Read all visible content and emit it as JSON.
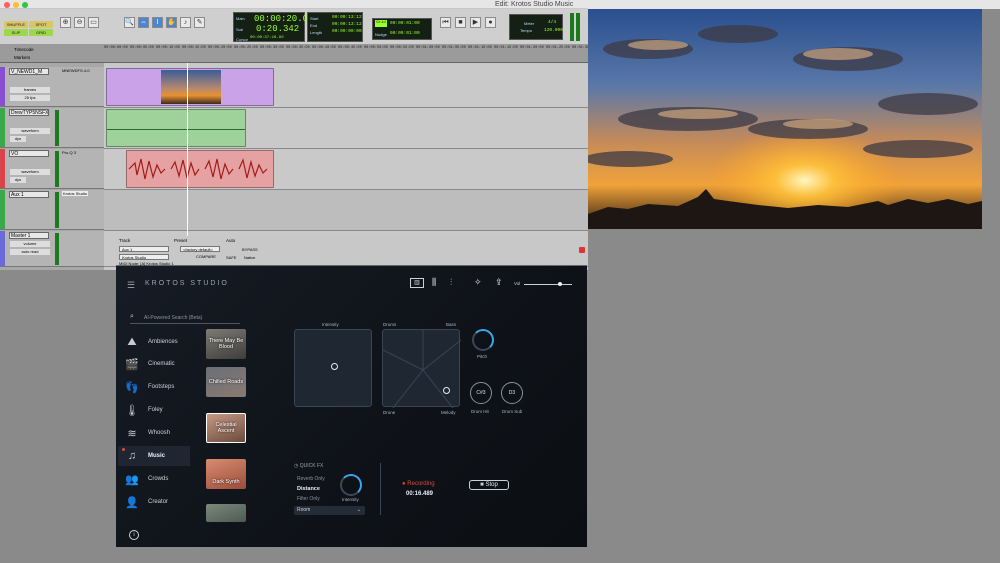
{
  "protools": {
    "window_title": "Edit: Krotos Studio Music",
    "modes": [
      "SHUFFLE",
      "SPOT",
      "SLIP",
      "GRID"
    ],
    "counters": {
      "main_label": "Main",
      "main_value": "00:00:20.08",
      "sub_label": "Sub",
      "sub_value": "0:20.342",
      "start_label": "Start",
      "start_value": "00:00:13:12",
      "end_label": "End",
      "end_value": "00:00:13:12",
      "length_label": "Length",
      "length_value": "00:00:00:00",
      "cursor_label": "Cursor",
      "cursor_value": "00:00:37:16.90",
      "nudge_label": "Nudge",
      "nudge_value": "00:00:01:00",
      "grid_value": "00:00:01:00"
    },
    "tempo": {
      "meter_label": "Meter",
      "meter_value": "4/4",
      "tempo_label": "Tempo",
      "tempo_value": "120.000"
    },
    "ruler": {
      "timecode_label": "Timecode",
      "markers_label": "Markers",
      "ticks": [
        "00:00:00:00",
        "00:00:05:00",
        "00:00:10:00",
        "00:00:15:00",
        "00:00:20:00",
        "00:00:25:00",
        "00:00:30:00",
        "00:00:35:00",
        "00:00:40:00",
        "00:00:45:00",
        "00:00:50:00",
        "00:00:55:00",
        "00:01:00:00",
        "00:01:05:00",
        "00:01:10:00",
        "00:01:15:00",
        "00:01:20:00",
        "00:01:25:00",
        "00:01:30:00"
      ]
    },
    "tracks": [
      {
        "name": "V_NEWD1_M",
        "insert": "MNEWDFS.4-0",
        "sub1": "frames",
        "sub2": "25 fps"
      },
      {
        "name": "DrewTYP5NSFX",
        "insert": "",
        "sub1": "waveform",
        "sub2": "dyn"
      },
      {
        "name": "VO",
        "insert": "Pro-Q 3",
        "sub1": "waveform",
        "sub2": "dyn"
      },
      {
        "name": "Aux 1",
        "insert": "Krotos Studio",
        "sub1": "",
        "sub2": ""
      },
      {
        "name": "Master 1",
        "insert": "",
        "sub1": "volume",
        "sub2": "auto read"
      }
    ]
  },
  "video": {
    "window_title": ""
  },
  "plugin_header": {
    "track_label": "Track",
    "track_value": "Aux 1",
    "preset_label": "Preset",
    "preset_value": "<factory default>",
    "auto_label": "Auto",
    "bypass": "BYPASS",
    "compare": "COMPARE",
    "safe": "SAFE",
    "native": "Native",
    "instance": "Krotos Studio",
    "node": "MIDI Node: [A] Krotos Studio 1"
  },
  "krotos": {
    "logo": "KROTOS STUDIO",
    "search_placeholder": "AI-Powered Search (Beta)",
    "vol_label": "Vol",
    "nav": [
      "Ambiences",
      "Cinematic",
      "Footsteps",
      "Foley",
      "Whoosh",
      "Music",
      "Crowds",
      "Creator"
    ],
    "active_nav": "Music",
    "presets": [
      "There May Be Blood",
      "Chilled Roads",
      "Celestial Ascent",
      "Dark Synth",
      ""
    ],
    "selected_preset": "Celestial Ascent",
    "pads": {
      "intensity": "Intensity",
      "drums": "Drums",
      "bass": "Bass",
      "drone": "Drone",
      "melody": "Melody"
    },
    "controls": {
      "pitch": "Pitch",
      "drum_hit_note": "C#3",
      "drum_hit": "Drum Hit",
      "drum_sub_note": "D3",
      "drum_sub": "Drum Sub"
    },
    "quick_fx": {
      "title": "QUICK FX",
      "options": [
        "Reverb Only",
        "Distance",
        "Filter Only"
      ],
      "selected": "Distance",
      "knob": "Intensity",
      "dropdown": "Room"
    },
    "recording": {
      "label": "Recording",
      "time": "00:16.489",
      "stop": "Stop"
    }
  }
}
